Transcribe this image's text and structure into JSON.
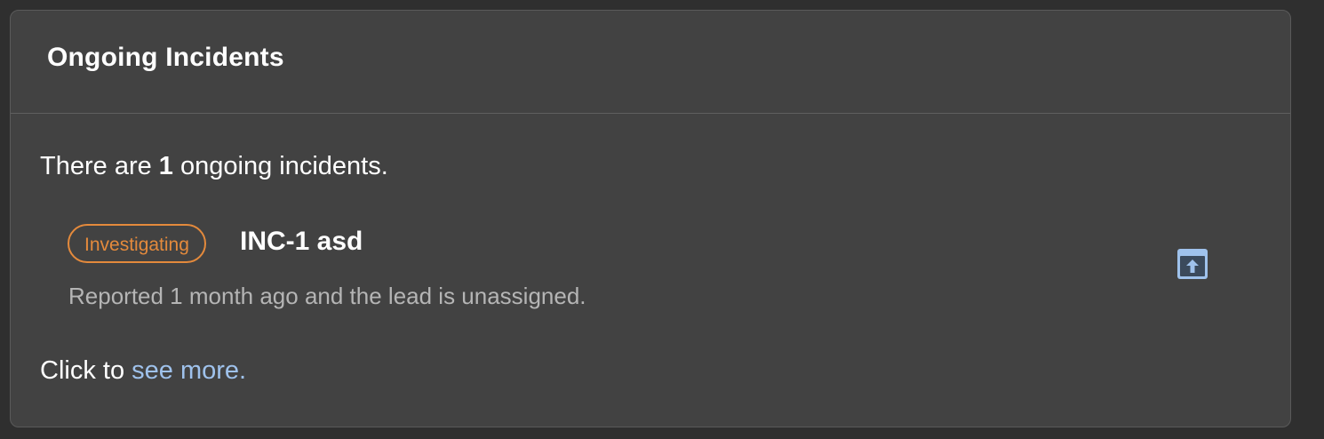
{
  "card": {
    "title": "Ongoing Incidents"
  },
  "summary": {
    "prefix": "There are ",
    "count": "1",
    "suffix": " ongoing incidents."
  },
  "incidents": [
    {
      "status": "Investigating",
      "status_color": "#e48a3c",
      "title": "INC-1 asd",
      "meta": "Reported 1 month ago and the lead is unassigned.",
      "open_icon": "open-in-new-window-icon"
    }
  ],
  "footer": {
    "prefix": "Click to ",
    "link_label": "see more.",
    "link_color": "#9fc2ec"
  }
}
